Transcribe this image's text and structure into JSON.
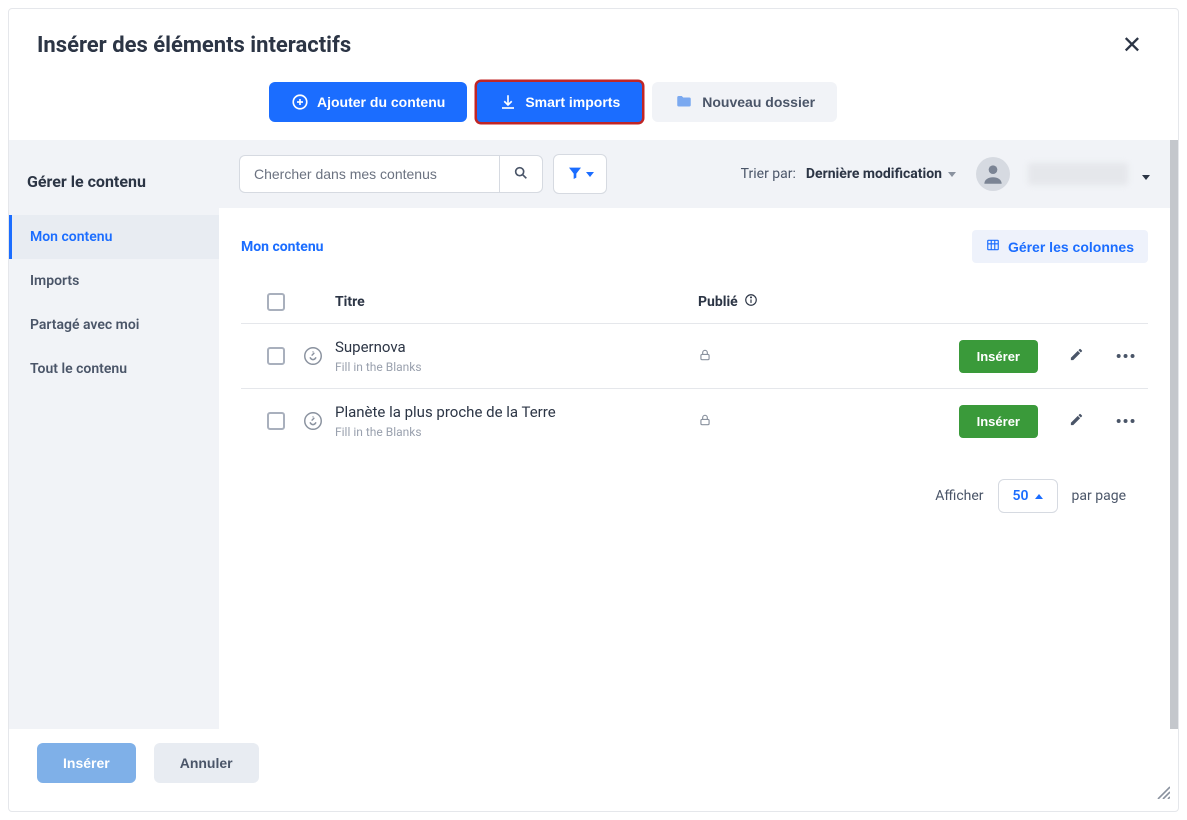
{
  "modal": {
    "title": "Insérer des éléments interactifs"
  },
  "toolbar": {
    "add_content": "Ajouter du contenu",
    "smart_imports": "Smart imports",
    "new_folder": "Nouveau dossier"
  },
  "sidebar": {
    "title": "Gérer le contenu",
    "items": [
      {
        "label": "Mon contenu",
        "active": true
      },
      {
        "label": "Imports",
        "active": false
      },
      {
        "label": "Partagé avec moi",
        "active": false
      },
      {
        "label": "Tout le contenu",
        "active": false
      }
    ]
  },
  "filter": {
    "search_placeholder": "Chercher dans mes contenus",
    "sort_label": "Trier par:",
    "sort_value": "Dernière modification"
  },
  "content": {
    "breadcrumb": "Mon contenu",
    "manage_columns": "Gérer les colonnes",
    "headers": {
      "title": "Titre",
      "published": "Publié"
    },
    "rows": [
      {
        "title": "Supernova",
        "subtitle": "Fill in the Blanks",
        "insert": "Insérer"
      },
      {
        "title": "Planète la plus proche de la Terre",
        "subtitle": "Fill in the Blanks",
        "insert": "Insérer"
      }
    ]
  },
  "pager": {
    "show_label": "Afficher",
    "per_page": "50",
    "suffix": "par page"
  },
  "footer": {
    "insert": "Insérer",
    "cancel": "Annuler"
  }
}
